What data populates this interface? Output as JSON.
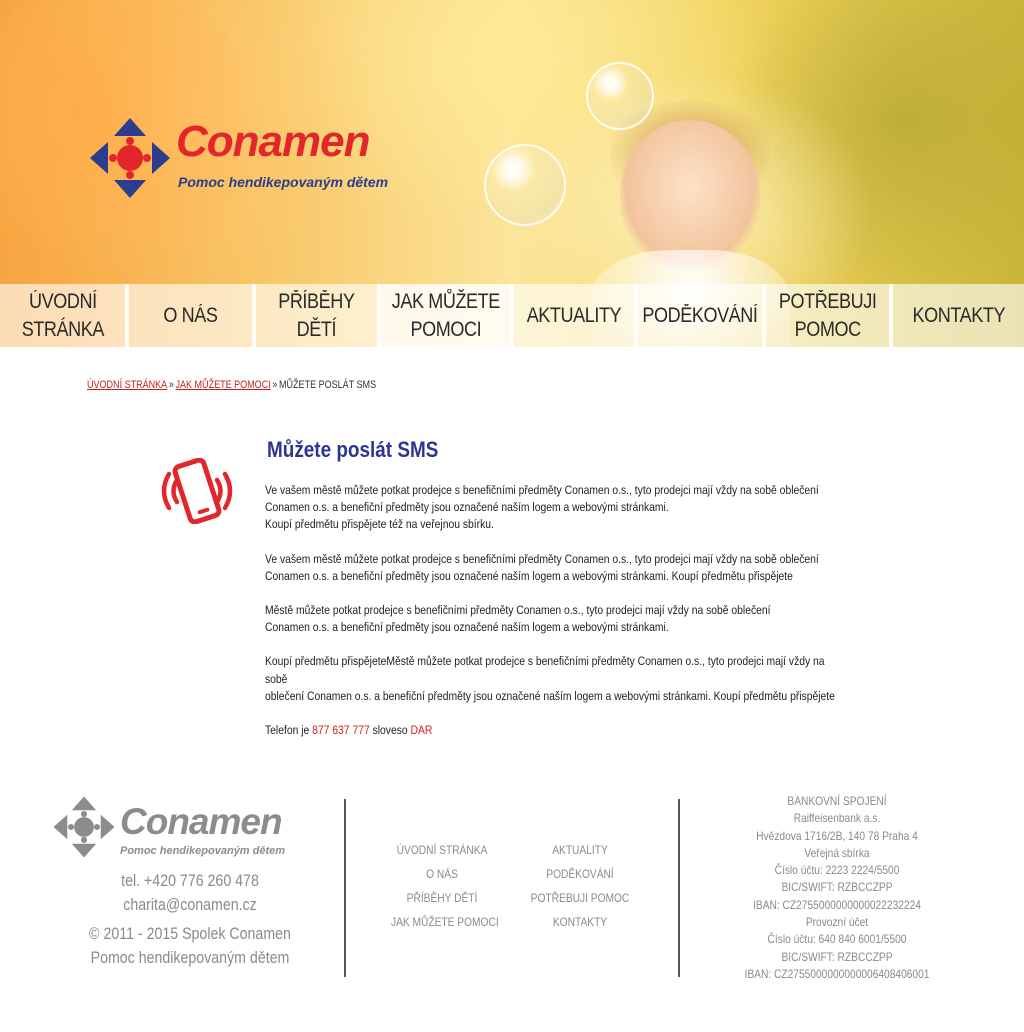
{
  "brand": {
    "name": "Conamen",
    "tagline": "Pomoc hendikepovaným dětem",
    "colors": {
      "red": "#e3262b",
      "blue": "#2c3d8f",
      "footer_gray": "#8a8a8a"
    }
  },
  "nav": {
    "items": [
      {
        "label": "ÚVODNÍ\nSTRÁNKA"
      },
      {
        "label": "O NÁS"
      },
      {
        "label": "PŘÍBĚHY\nDĚTÍ"
      },
      {
        "label": "JAK MŮŽETE\nPOMOCI"
      },
      {
        "label": "AKTUALITY"
      },
      {
        "label": "PODĚKOVÁNÍ"
      },
      {
        "label": "POTŘEBUJI\nPOMOC"
      },
      {
        "label": "KONTAKTY"
      }
    ]
  },
  "breadcrumb": {
    "home": "ÚVODNÍ STRÁNKA",
    "section": "JAK MŮŽETE POMOCI",
    "current": "MŮŽETE POSLÁT SMS",
    "separator": "»"
  },
  "content": {
    "icon": "phone-vibrate-icon",
    "title": "Můžete poslát SMS",
    "paragraphs": [
      [
        "Ve vašem městě můžete potkat prodejce s benefičními předměty Conamen o.s., tyto prodejci mají vždy na sobě oblečení",
        "Conamen o.s. a benefiční předměty jsou označené naším logem a webovými stránkami.",
        "Koupí předmětu přispějete též na veřejnou sbírku."
      ],
      [
        "Ve vašem městě můžete potkat prodejce s benefičními předměty Conamen o.s., tyto prodejci mají vždy na sobě oblečení",
        "Conamen o.s. a benefiční předměty jsou označené naším logem a webovými stránkami. Koupí předmětu přispějete"
      ],
      [
        "Městě můžete potkat prodejce s benefičními předměty Conamen o.s., tyto prodejci mají vždy na sobě oblečení",
        "Conamen o.s. a benefiční předměty jsou označené naším logem a webovými stránkami."
      ],
      [
        "Koupí předmětu přispějeteMěstě můžete potkat prodejce s benefičními předměty Conamen o.s., tyto prodejci mají vždy na sobě",
        "oblečení Conamen o.s. a benefiční předměty jsou označené naším logem a webovými stránkami. Koupí předmětu přispějete"
      ]
    ],
    "phone_line": {
      "prefix": "Telefon je ",
      "number": "877 637 777",
      "middle": " sloveso ",
      "keyword": "DAR"
    }
  },
  "footer": {
    "phone": "tel. +420 776 260 478",
    "email": "charita@conamen.cz",
    "copyright": "© 2011 - 2015 Spolek Conamen",
    "copyright_sub": "Pomoc hendikepovaným dětem",
    "links_left": [
      "ÚVODNÍ STRÁNKA",
      "O NÁS",
      "PŘÍBĚHY DĚTÍ",
      "JAK MŮŽETE POMOCI"
    ],
    "links_right": [
      "AKTUALITY",
      "PODĚKOVÁNÍ",
      "POTŘEBUJI POMOC",
      "KONTAKTY"
    ],
    "bank": [
      "BANKOVNÍ SPOJENÍ",
      "Raiffeisenbank a.s.",
      "Hvězdova 1716/2B, 140 78 Praha 4",
      "Veřejná sbírka",
      "Číslo účtu: 2223 2224/5500",
      "BIC/SWIFT: RZBCCZPP",
      "IBAN: CZ2755000000000022232224",
      "Provozní účet",
      "Číslo účtu: 640 840 6001/5500",
      "BIC/SWIFT: RZBCCZPP",
      "IBAN: CZ2755000000000006408406001"
    ]
  }
}
